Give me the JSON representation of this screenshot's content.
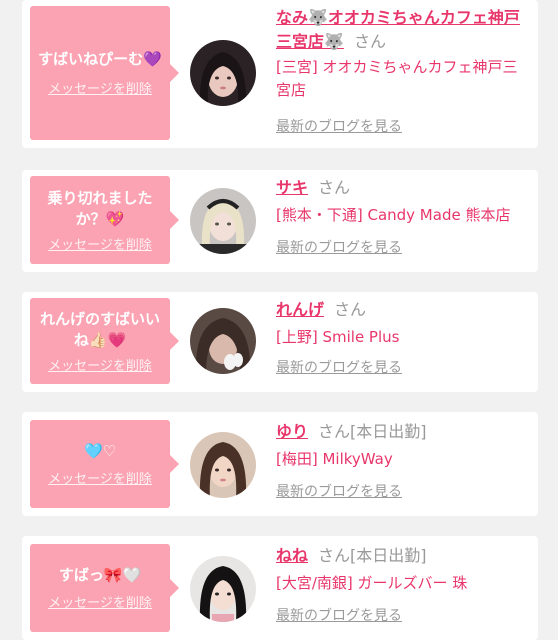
{
  "colors": {
    "background": "#f1f1f1",
    "card": "#ffffff",
    "bubble": "#fba3b2",
    "accent": "#e8366b",
    "muted": "#999999"
  },
  "messages": [
    {
      "message": "すばいねぴーむ💜",
      "delete_label": "メッセージを削除",
      "name": "なみ🐺オオカミちゃんカフェ神戸三宮店🐺",
      "suffix": "さん",
      "work_status": "",
      "shop": "[三宮] オオカミちゃんカフェ神戸三宮店",
      "blog_label": "最新のブログを見る",
      "avatar_icon": "profile-photo"
    },
    {
      "message": "乗り切れました\nか？💖",
      "delete_label": "メッセージを削除",
      "name": "サキ",
      "suffix": "さん",
      "work_status": "",
      "shop": "[熊本・下通] Candy Made 熊本店",
      "blog_label": "最新のブログを見る",
      "avatar_icon": "profile-photo"
    },
    {
      "message": "れんげのすばいい\nね👍🏻💗",
      "delete_label": "メッセージを削除",
      "name": "れんげ",
      "suffix": "さん",
      "work_status": "",
      "shop": "[上野] Smile Plus",
      "blog_label": "最新のブログを見る",
      "avatar_icon": "profile-photo"
    },
    {
      "message": "🩵♡",
      "delete_label": "メッセージを削除",
      "name": "ゆり",
      "suffix": "さん",
      "work_status": "[本日出勤]",
      "shop": "[梅田] MilkyWay",
      "blog_label": "最新のブログを見る",
      "avatar_icon": "profile-photo"
    },
    {
      "message": "すばっ🎀🤍",
      "delete_label": "メッセージを削除",
      "name": "ねね",
      "suffix": "さん",
      "work_status": "[本日出勤]",
      "shop": "[大宮/南銀] ガールズバー 珠",
      "blog_label": "最新のブログを見る",
      "avatar_icon": "profile-photo"
    }
  ]
}
